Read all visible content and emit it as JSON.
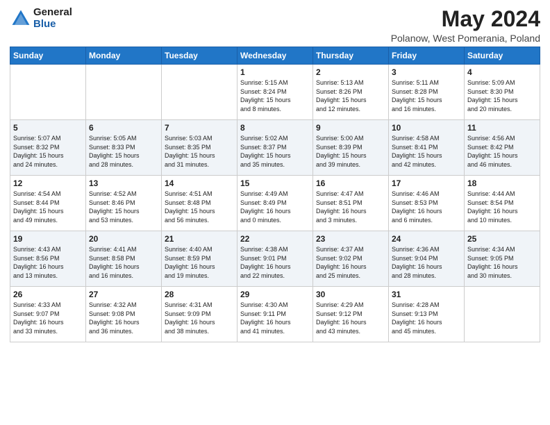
{
  "logo": {
    "general": "General",
    "blue": "Blue"
  },
  "header": {
    "title": "May 2024",
    "subtitle": "Polanow, West Pomerania, Poland"
  },
  "days_of_week": [
    "Sunday",
    "Monday",
    "Tuesday",
    "Wednesday",
    "Thursday",
    "Friday",
    "Saturday"
  ],
  "weeks": [
    [
      {
        "day": "",
        "info": ""
      },
      {
        "day": "",
        "info": ""
      },
      {
        "day": "",
        "info": ""
      },
      {
        "day": "1",
        "info": "Sunrise: 5:15 AM\nSunset: 8:24 PM\nDaylight: 15 hours\nand 8 minutes."
      },
      {
        "day": "2",
        "info": "Sunrise: 5:13 AM\nSunset: 8:26 PM\nDaylight: 15 hours\nand 12 minutes."
      },
      {
        "day": "3",
        "info": "Sunrise: 5:11 AM\nSunset: 8:28 PM\nDaylight: 15 hours\nand 16 minutes."
      },
      {
        "day": "4",
        "info": "Sunrise: 5:09 AM\nSunset: 8:30 PM\nDaylight: 15 hours\nand 20 minutes."
      }
    ],
    [
      {
        "day": "5",
        "info": "Sunrise: 5:07 AM\nSunset: 8:32 PM\nDaylight: 15 hours\nand 24 minutes."
      },
      {
        "day": "6",
        "info": "Sunrise: 5:05 AM\nSunset: 8:33 PM\nDaylight: 15 hours\nand 28 minutes."
      },
      {
        "day": "7",
        "info": "Sunrise: 5:03 AM\nSunset: 8:35 PM\nDaylight: 15 hours\nand 31 minutes."
      },
      {
        "day": "8",
        "info": "Sunrise: 5:02 AM\nSunset: 8:37 PM\nDaylight: 15 hours\nand 35 minutes."
      },
      {
        "day": "9",
        "info": "Sunrise: 5:00 AM\nSunset: 8:39 PM\nDaylight: 15 hours\nand 39 minutes."
      },
      {
        "day": "10",
        "info": "Sunrise: 4:58 AM\nSunset: 8:41 PM\nDaylight: 15 hours\nand 42 minutes."
      },
      {
        "day": "11",
        "info": "Sunrise: 4:56 AM\nSunset: 8:42 PM\nDaylight: 15 hours\nand 46 minutes."
      }
    ],
    [
      {
        "day": "12",
        "info": "Sunrise: 4:54 AM\nSunset: 8:44 PM\nDaylight: 15 hours\nand 49 minutes."
      },
      {
        "day": "13",
        "info": "Sunrise: 4:52 AM\nSunset: 8:46 PM\nDaylight: 15 hours\nand 53 minutes."
      },
      {
        "day": "14",
        "info": "Sunrise: 4:51 AM\nSunset: 8:48 PM\nDaylight: 15 hours\nand 56 minutes."
      },
      {
        "day": "15",
        "info": "Sunrise: 4:49 AM\nSunset: 8:49 PM\nDaylight: 16 hours\nand 0 minutes."
      },
      {
        "day": "16",
        "info": "Sunrise: 4:47 AM\nSunset: 8:51 PM\nDaylight: 16 hours\nand 3 minutes."
      },
      {
        "day": "17",
        "info": "Sunrise: 4:46 AM\nSunset: 8:53 PM\nDaylight: 16 hours\nand 6 minutes."
      },
      {
        "day": "18",
        "info": "Sunrise: 4:44 AM\nSunset: 8:54 PM\nDaylight: 16 hours\nand 10 minutes."
      }
    ],
    [
      {
        "day": "19",
        "info": "Sunrise: 4:43 AM\nSunset: 8:56 PM\nDaylight: 16 hours\nand 13 minutes."
      },
      {
        "day": "20",
        "info": "Sunrise: 4:41 AM\nSunset: 8:58 PM\nDaylight: 16 hours\nand 16 minutes."
      },
      {
        "day": "21",
        "info": "Sunrise: 4:40 AM\nSunset: 8:59 PM\nDaylight: 16 hours\nand 19 minutes."
      },
      {
        "day": "22",
        "info": "Sunrise: 4:38 AM\nSunset: 9:01 PM\nDaylight: 16 hours\nand 22 minutes."
      },
      {
        "day": "23",
        "info": "Sunrise: 4:37 AM\nSunset: 9:02 PM\nDaylight: 16 hours\nand 25 minutes."
      },
      {
        "day": "24",
        "info": "Sunrise: 4:36 AM\nSunset: 9:04 PM\nDaylight: 16 hours\nand 28 minutes."
      },
      {
        "day": "25",
        "info": "Sunrise: 4:34 AM\nSunset: 9:05 PM\nDaylight: 16 hours\nand 30 minutes."
      }
    ],
    [
      {
        "day": "26",
        "info": "Sunrise: 4:33 AM\nSunset: 9:07 PM\nDaylight: 16 hours\nand 33 minutes."
      },
      {
        "day": "27",
        "info": "Sunrise: 4:32 AM\nSunset: 9:08 PM\nDaylight: 16 hours\nand 36 minutes."
      },
      {
        "day": "28",
        "info": "Sunrise: 4:31 AM\nSunset: 9:09 PM\nDaylight: 16 hours\nand 38 minutes."
      },
      {
        "day": "29",
        "info": "Sunrise: 4:30 AM\nSunset: 9:11 PM\nDaylight: 16 hours\nand 41 minutes."
      },
      {
        "day": "30",
        "info": "Sunrise: 4:29 AM\nSunset: 9:12 PM\nDaylight: 16 hours\nand 43 minutes."
      },
      {
        "day": "31",
        "info": "Sunrise: 4:28 AM\nSunset: 9:13 PM\nDaylight: 16 hours\nand 45 minutes."
      },
      {
        "day": "",
        "info": ""
      }
    ]
  ]
}
